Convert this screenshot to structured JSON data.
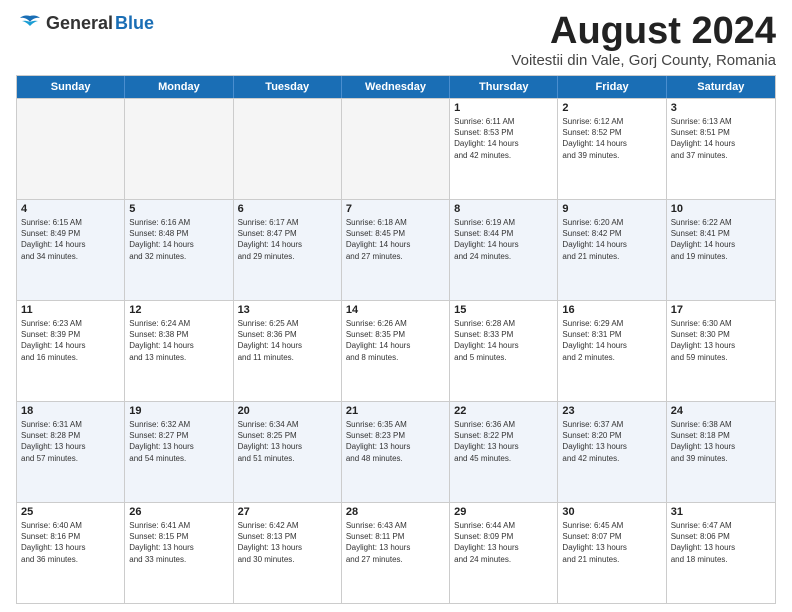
{
  "logo": {
    "general": "General",
    "blue": "Blue"
  },
  "title": "August 2024",
  "subtitle": "Voitestii din Vale, Gorj County, Romania",
  "days": [
    "Sunday",
    "Monday",
    "Tuesday",
    "Wednesday",
    "Thursday",
    "Friday",
    "Saturday"
  ],
  "weeks": [
    [
      {
        "day": "",
        "empty": true
      },
      {
        "day": "",
        "empty": true
      },
      {
        "day": "",
        "empty": true
      },
      {
        "day": "",
        "empty": true
      },
      {
        "day": "1",
        "lines": [
          "Sunrise: 6:11 AM",
          "Sunset: 8:53 PM",
          "Daylight: 14 hours",
          "and 42 minutes."
        ]
      },
      {
        "day": "2",
        "lines": [
          "Sunrise: 6:12 AM",
          "Sunset: 8:52 PM",
          "Daylight: 14 hours",
          "and 39 minutes."
        ]
      },
      {
        "day": "3",
        "lines": [
          "Sunrise: 6:13 AM",
          "Sunset: 8:51 PM",
          "Daylight: 14 hours",
          "and 37 minutes."
        ]
      }
    ],
    [
      {
        "day": "4",
        "lines": [
          "Sunrise: 6:15 AM",
          "Sunset: 8:49 PM",
          "Daylight: 14 hours",
          "and 34 minutes."
        ]
      },
      {
        "day": "5",
        "lines": [
          "Sunrise: 6:16 AM",
          "Sunset: 8:48 PM",
          "Daylight: 14 hours",
          "and 32 minutes."
        ]
      },
      {
        "day": "6",
        "lines": [
          "Sunrise: 6:17 AM",
          "Sunset: 8:47 PM",
          "Daylight: 14 hours",
          "and 29 minutes."
        ]
      },
      {
        "day": "7",
        "lines": [
          "Sunrise: 6:18 AM",
          "Sunset: 8:45 PM",
          "Daylight: 14 hours",
          "and 27 minutes."
        ]
      },
      {
        "day": "8",
        "lines": [
          "Sunrise: 6:19 AM",
          "Sunset: 8:44 PM",
          "Daylight: 14 hours",
          "and 24 minutes."
        ]
      },
      {
        "day": "9",
        "lines": [
          "Sunrise: 6:20 AM",
          "Sunset: 8:42 PM",
          "Daylight: 14 hours",
          "and 21 minutes."
        ]
      },
      {
        "day": "10",
        "lines": [
          "Sunrise: 6:22 AM",
          "Sunset: 8:41 PM",
          "Daylight: 14 hours",
          "and 19 minutes."
        ]
      }
    ],
    [
      {
        "day": "11",
        "lines": [
          "Sunrise: 6:23 AM",
          "Sunset: 8:39 PM",
          "Daylight: 14 hours",
          "and 16 minutes."
        ]
      },
      {
        "day": "12",
        "lines": [
          "Sunrise: 6:24 AM",
          "Sunset: 8:38 PM",
          "Daylight: 14 hours",
          "and 13 minutes."
        ]
      },
      {
        "day": "13",
        "lines": [
          "Sunrise: 6:25 AM",
          "Sunset: 8:36 PM",
          "Daylight: 14 hours",
          "and 11 minutes."
        ]
      },
      {
        "day": "14",
        "lines": [
          "Sunrise: 6:26 AM",
          "Sunset: 8:35 PM",
          "Daylight: 14 hours",
          "and 8 minutes."
        ]
      },
      {
        "day": "15",
        "lines": [
          "Sunrise: 6:28 AM",
          "Sunset: 8:33 PM",
          "Daylight: 14 hours",
          "and 5 minutes."
        ]
      },
      {
        "day": "16",
        "lines": [
          "Sunrise: 6:29 AM",
          "Sunset: 8:31 PM",
          "Daylight: 14 hours",
          "and 2 minutes."
        ]
      },
      {
        "day": "17",
        "lines": [
          "Sunrise: 6:30 AM",
          "Sunset: 8:30 PM",
          "Daylight: 13 hours",
          "and 59 minutes."
        ]
      }
    ],
    [
      {
        "day": "18",
        "lines": [
          "Sunrise: 6:31 AM",
          "Sunset: 8:28 PM",
          "Daylight: 13 hours",
          "and 57 minutes."
        ]
      },
      {
        "day": "19",
        "lines": [
          "Sunrise: 6:32 AM",
          "Sunset: 8:27 PM",
          "Daylight: 13 hours",
          "and 54 minutes."
        ]
      },
      {
        "day": "20",
        "lines": [
          "Sunrise: 6:34 AM",
          "Sunset: 8:25 PM",
          "Daylight: 13 hours",
          "and 51 minutes."
        ]
      },
      {
        "day": "21",
        "lines": [
          "Sunrise: 6:35 AM",
          "Sunset: 8:23 PM",
          "Daylight: 13 hours",
          "and 48 minutes."
        ]
      },
      {
        "day": "22",
        "lines": [
          "Sunrise: 6:36 AM",
          "Sunset: 8:22 PM",
          "Daylight: 13 hours",
          "and 45 minutes."
        ]
      },
      {
        "day": "23",
        "lines": [
          "Sunrise: 6:37 AM",
          "Sunset: 8:20 PM",
          "Daylight: 13 hours",
          "and 42 minutes."
        ]
      },
      {
        "day": "24",
        "lines": [
          "Sunrise: 6:38 AM",
          "Sunset: 8:18 PM",
          "Daylight: 13 hours",
          "and 39 minutes."
        ]
      }
    ],
    [
      {
        "day": "25",
        "lines": [
          "Sunrise: 6:40 AM",
          "Sunset: 8:16 PM",
          "Daylight: 13 hours",
          "and 36 minutes."
        ]
      },
      {
        "day": "26",
        "lines": [
          "Sunrise: 6:41 AM",
          "Sunset: 8:15 PM",
          "Daylight: 13 hours",
          "and 33 minutes."
        ]
      },
      {
        "day": "27",
        "lines": [
          "Sunrise: 6:42 AM",
          "Sunset: 8:13 PM",
          "Daylight: 13 hours",
          "and 30 minutes."
        ]
      },
      {
        "day": "28",
        "lines": [
          "Sunrise: 6:43 AM",
          "Sunset: 8:11 PM",
          "Daylight: 13 hours",
          "and 27 minutes."
        ]
      },
      {
        "day": "29",
        "lines": [
          "Sunrise: 6:44 AM",
          "Sunset: 8:09 PM",
          "Daylight: 13 hours",
          "and 24 minutes."
        ]
      },
      {
        "day": "30",
        "lines": [
          "Sunrise: 6:45 AM",
          "Sunset: 8:07 PM",
          "Daylight: 13 hours",
          "and 21 minutes."
        ]
      },
      {
        "day": "31",
        "lines": [
          "Sunrise: 6:47 AM",
          "Sunset: 8:06 PM",
          "Daylight: 13 hours",
          "and 18 minutes."
        ]
      }
    ]
  ]
}
